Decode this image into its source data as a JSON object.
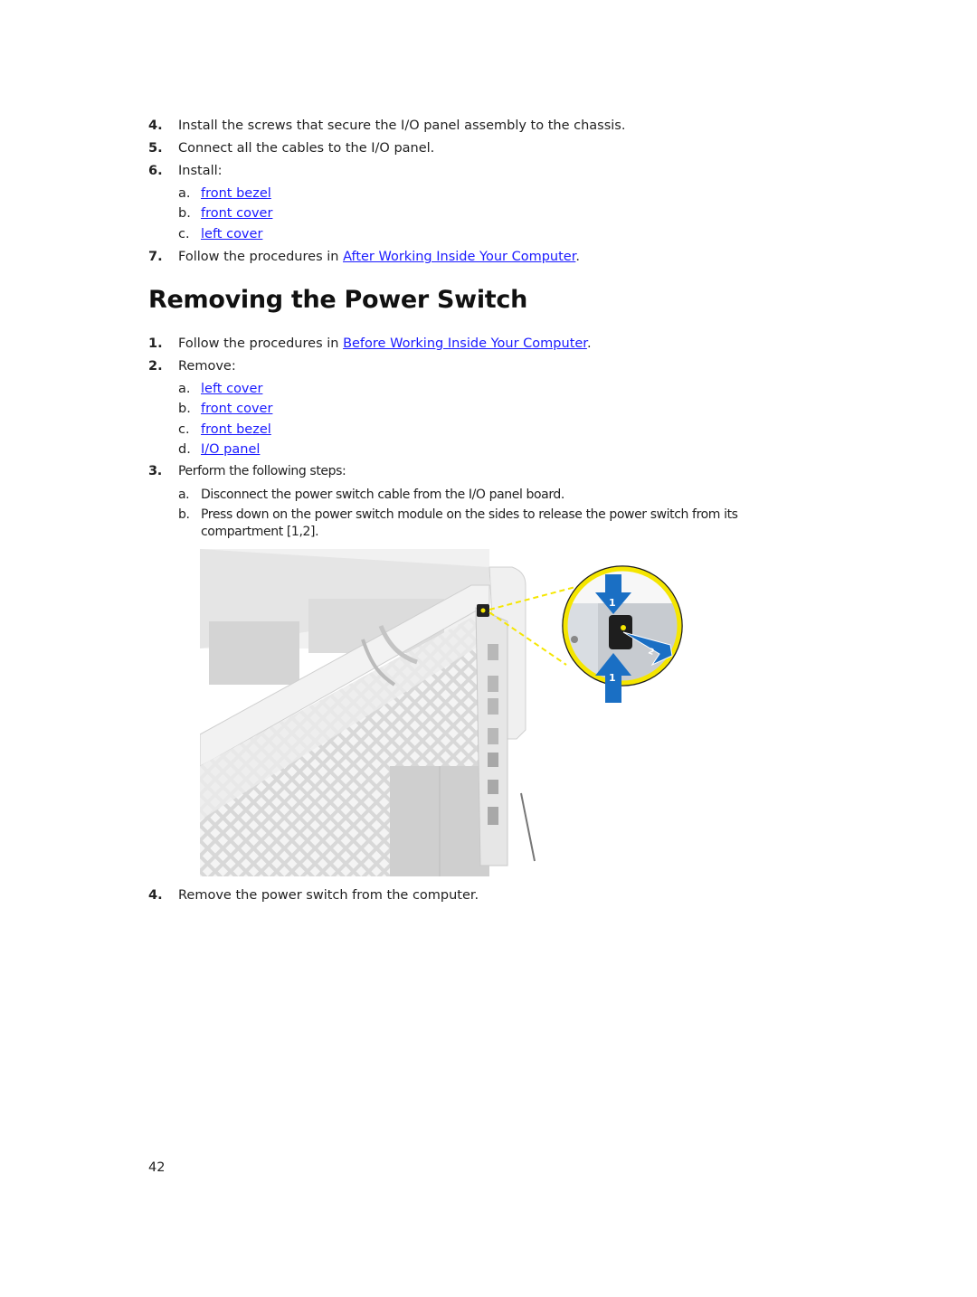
{
  "steps_top": [
    {
      "num": "4.",
      "text": "Install the screws that secure the I/O panel assembly to the chassis."
    },
    {
      "num": "5.",
      "text": "Connect all the cables to the I/O panel."
    },
    {
      "num": "6.",
      "text": "Install:"
    }
  ],
  "install_items": [
    {
      "letter": "a.",
      "link": "front bezel"
    },
    {
      "letter": "b.",
      "link": "front cover"
    },
    {
      "letter": "c.",
      "link": "left cover"
    }
  ],
  "step7": {
    "num": "7.",
    "prefix": "Follow the procedures in ",
    "link": "After Working Inside Your Computer",
    "suffix": "."
  },
  "section_title": "Removing the Power Switch",
  "remove_steps": {
    "step1": {
      "num": "1.",
      "prefix": "Follow the procedures in ",
      "link": "Before Working Inside Your Computer",
      "suffix": "."
    },
    "step2": {
      "num": "2.",
      "text": "Remove:"
    },
    "remove_items": [
      {
        "letter": "a.",
        "link": "left cover"
      },
      {
        "letter": "b.",
        "link": "front cover"
      },
      {
        "letter": "c.",
        "link": "front bezel"
      },
      {
        "letter": "d.",
        "link": "I/O panel"
      }
    ],
    "step3": {
      "num": "3.",
      "text": "Perform the following steps:"
    },
    "step3_items": [
      {
        "letter": "a.",
        "text": "Disconnect the power switch cable from the I/O panel board."
      },
      {
        "letter": "b.",
        "text": "Press down on the power switch module on the sides to release the power switch from its",
        "text2": "compartment [1,2]."
      }
    ],
    "step4": {
      "num": "4.",
      "text": "Remove the power switch from the computer."
    }
  },
  "figure": {
    "callout_labels": [
      "1",
      "2",
      "1"
    ],
    "colors": {
      "callout_ring": "#f5e600",
      "arrow": "#1a6fc4",
      "chassis": "#e6e6e6"
    }
  },
  "page_number": "42"
}
